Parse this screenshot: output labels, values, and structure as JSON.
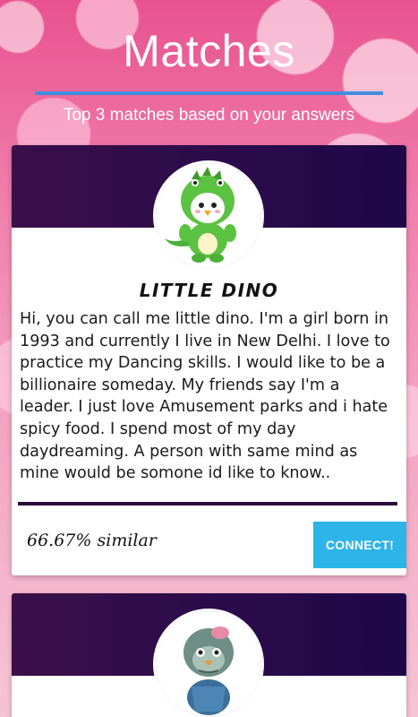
{
  "header": {
    "title": "Matches",
    "subtitle": "Top 3 matches based on your answers"
  },
  "matches": [
    {
      "name": "LITTLE DINO",
      "avatar_icon": "dino-costume-avatar-icon",
      "bio": "Hi, you can call me little dino. I'm a girl born in 1993 and currently I live in New Delhi. I love to practice my Dancing skills. I would like to be a billionaire someday. My friends say I'm a leader. I just love Amusement parks and i hate spicy food. I spend most of my day daydreaming. A person with same mind as mine would be somone id like to know..",
      "similarity": "66.67% similar",
      "connect_label": "CONNECT!"
    },
    {
      "avatar_icon": "zombie-penguin-avatar-icon"
    }
  ],
  "colors": {
    "accent": "#3f8ee0",
    "banner": "#2a0a4a",
    "connect": "#2db4e8",
    "background": "#f07aa9"
  }
}
